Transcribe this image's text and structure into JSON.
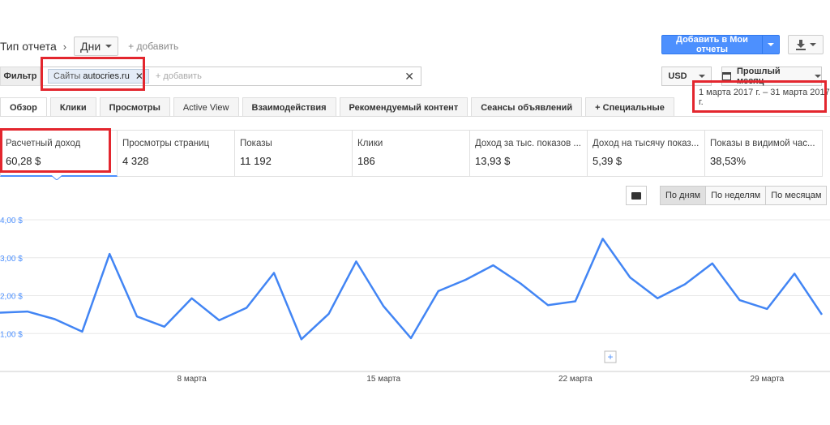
{
  "header": {
    "report_type_label": "Тип отчета",
    "breadcrumb_sep": "›",
    "granularity_dropdown": "Дни",
    "add_link": "+ добавить",
    "add_to_reports_button": "Добавить в Мои отчеты",
    "download_icon": "download-icon"
  },
  "filter": {
    "label": "Фильтр",
    "chip_prefix": "Сайты",
    "chip_value": "autocries.ru",
    "chip_close": "✕",
    "placeholder": "+ добавить",
    "clear": "✕"
  },
  "currency": "USD",
  "date": {
    "preset": "Прошлый месяц",
    "range": "1 марта 2017 г. – 31 марта 2017 г."
  },
  "tabs": [
    {
      "label": "Обзор"
    },
    {
      "label": "Клики"
    },
    {
      "label": "Просмотры"
    },
    {
      "label": "Active View"
    },
    {
      "label": "Взаимодействия"
    },
    {
      "label": "Рекомендуемый контент"
    },
    {
      "label": "Сеансы объявлений"
    },
    {
      "label": "+  Специальные"
    }
  ],
  "metrics": [
    {
      "label": "Расчетный доход",
      "value": "60,28 $"
    },
    {
      "label": "Просмотры страниц",
      "value": "4 328"
    },
    {
      "label": "Показы",
      "value": "11 192"
    },
    {
      "label": "Клики",
      "value": "186"
    },
    {
      "label": "Доход за тыс. показов ...",
      "value": "13,93 $"
    },
    {
      "label": "Доход на тысячу показ...",
      "value": "5,39 $"
    },
    {
      "label": "Показы в видимой час...",
      "value": "38,53%"
    }
  ],
  "granularity_buttons": [
    {
      "label": "По дням"
    },
    {
      "label": "По неделям"
    },
    {
      "label": "По месяцам"
    }
  ],
  "chart_data": {
    "type": "line",
    "x": [
      1,
      2,
      3,
      4,
      5,
      6,
      7,
      8,
      9,
      10,
      11,
      12,
      13,
      14,
      15,
      16,
      17,
      18,
      19,
      20,
      21,
      22,
      23,
      24,
      25,
      26,
      27,
      28,
      29,
      30,
      31
    ],
    "series": [
      {
        "values": [
          1.55,
          1.58,
          1.38,
          1.05,
          3.1,
          1.45,
          1.18,
          1.93,
          1.35,
          1.68,
          2.6,
          0.85,
          1.52,
          2.9,
          1.72,
          0.88,
          2.12,
          2.42,
          2.8,
          2.32,
          1.75,
          1.85,
          3.5,
          2.48,
          1.93,
          2.3,
          2.85,
          1.88,
          1.65,
          2.58,
          1.5
        ]
      }
    ],
    "color": "#4285f4",
    "ytick_labels": [
      "1,00 $",
      "2,00 $",
      "3,00 $",
      "4,00 $"
    ],
    "ytick_values": [
      1,
      2,
      3,
      4
    ],
    "ylim": [
      0,
      4.15
    ],
    "xtick_labels": [
      "8 марта",
      "15 марта",
      "22 марта",
      "29 марта"
    ],
    "xtick_values": [
      8,
      15,
      22,
      29
    ],
    "grid": true
  },
  "annotation_marker": "+"
}
